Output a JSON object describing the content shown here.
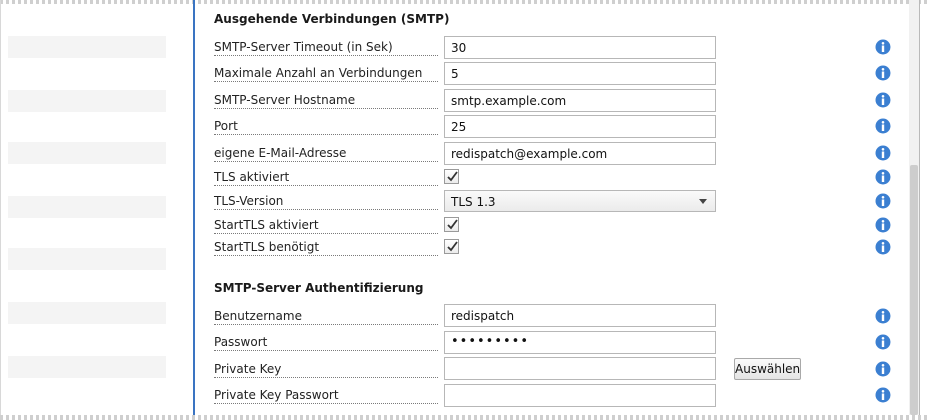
{
  "sections": {
    "outgoing_title": "Ausgehende Verbindungen (SMTP)",
    "auth_title": "SMTP-Server Authentifizierung"
  },
  "fields": {
    "timeout": {
      "label": "SMTP-Server Timeout (in Sek)",
      "value": "30"
    },
    "max_connections": {
      "label": "Maximale Anzahl an Verbindungen",
      "value": "5"
    },
    "hostname": {
      "label": "SMTP-Server Hostname",
      "value": "smtp.example.com"
    },
    "port": {
      "label": "Port",
      "value": "25"
    },
    "own_email": {
      "label": "eigene E-Mail-Adresse",
      "value": "redispatch@example.com"
    },
    "tls_enabled": {
      "label": "TLS aktiviert",
      "checked": true
    },
    "tls_version": {
      "label": "TLS-Version",
      "value": "TLS 1.3"
    },
    "starttls_enabled": {
      "label": "StartTLS aktiviert",
      "checked": true
    },
    "starttls_required": {
      "label": "StartTLS benötigt",
      "checked": true
    },
    "username": {
      "label": "Benutzername",
      "value": "redispatch"
    },
    "password": {
      "label": "Passwort",
      "value": "•••••••••"
    },
    "private_key": {
      "label": "Private Key",
      "value": "",
      "button": "Auswählen"
    },
    "private_key_password": {
      "label": "Private Key Passwort",
      "value": ""
    }
  },
  "icons": {
    "info": "info-circle-icon",
    "check": "checkmark-icon",
    "dropdown": "chevron-down-icon"
  },
  "colors": {
    "accent_divider": "#3a74c2",
    "info_icon": "#3b7fd1"
  }
}
